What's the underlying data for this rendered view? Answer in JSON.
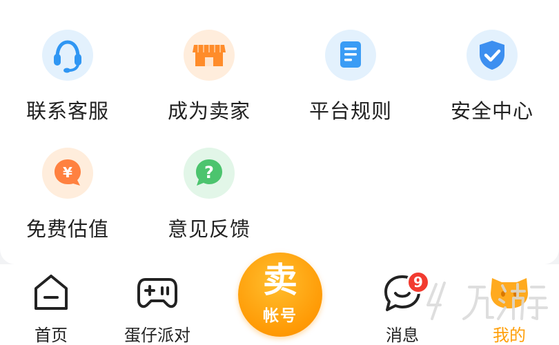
{
  "services": {
    "row1": [
      {
        "label": "联系客服",
        "icon": "headset-icon"
      },
      {
        "label": "成为卖家",
        "icon": "store-icon"
      },
      {
        "label": "平台规则",
        "icon": "document-icon"
      },
      {
        "label": "安全中心",
        "icon": "shield-check-icon"
      }
    ],
    "row2": [
      {
        "label": "免费估值",
        "icon": "yuan-bubble-icon"
      },
      {
        "label": "意见反馈",
        "icon": "question-bubble-icon"
      }
    ],
    "yuan_symbol": "¥",
    "question_symbol": "?"
  },
  "tabbar": {
    "tabs": [
      {
        "label": "首页",
        "icon": "home-icon",
        "active": false
      },
      {
        "label": "蛋仔派对",
        "icon": "gamepad-icon",
        "active": false
      },
      {
        "label": "消息",
        "icon": "chat-bubble-icon",
        "active": false,
        "badge": "9"
      },
      {
        "label": "我的",
        "icon": "cat-avatar-icon",
        "active": true
      }
    ],
    "sell_button": {
      "main": "卖",
      "sub": "帐号"
    }
  },
  "colors": {
    "accent": "#ff9f0a",
    "badge": "#f23b30",
    "text": "#222222"
  }
}
